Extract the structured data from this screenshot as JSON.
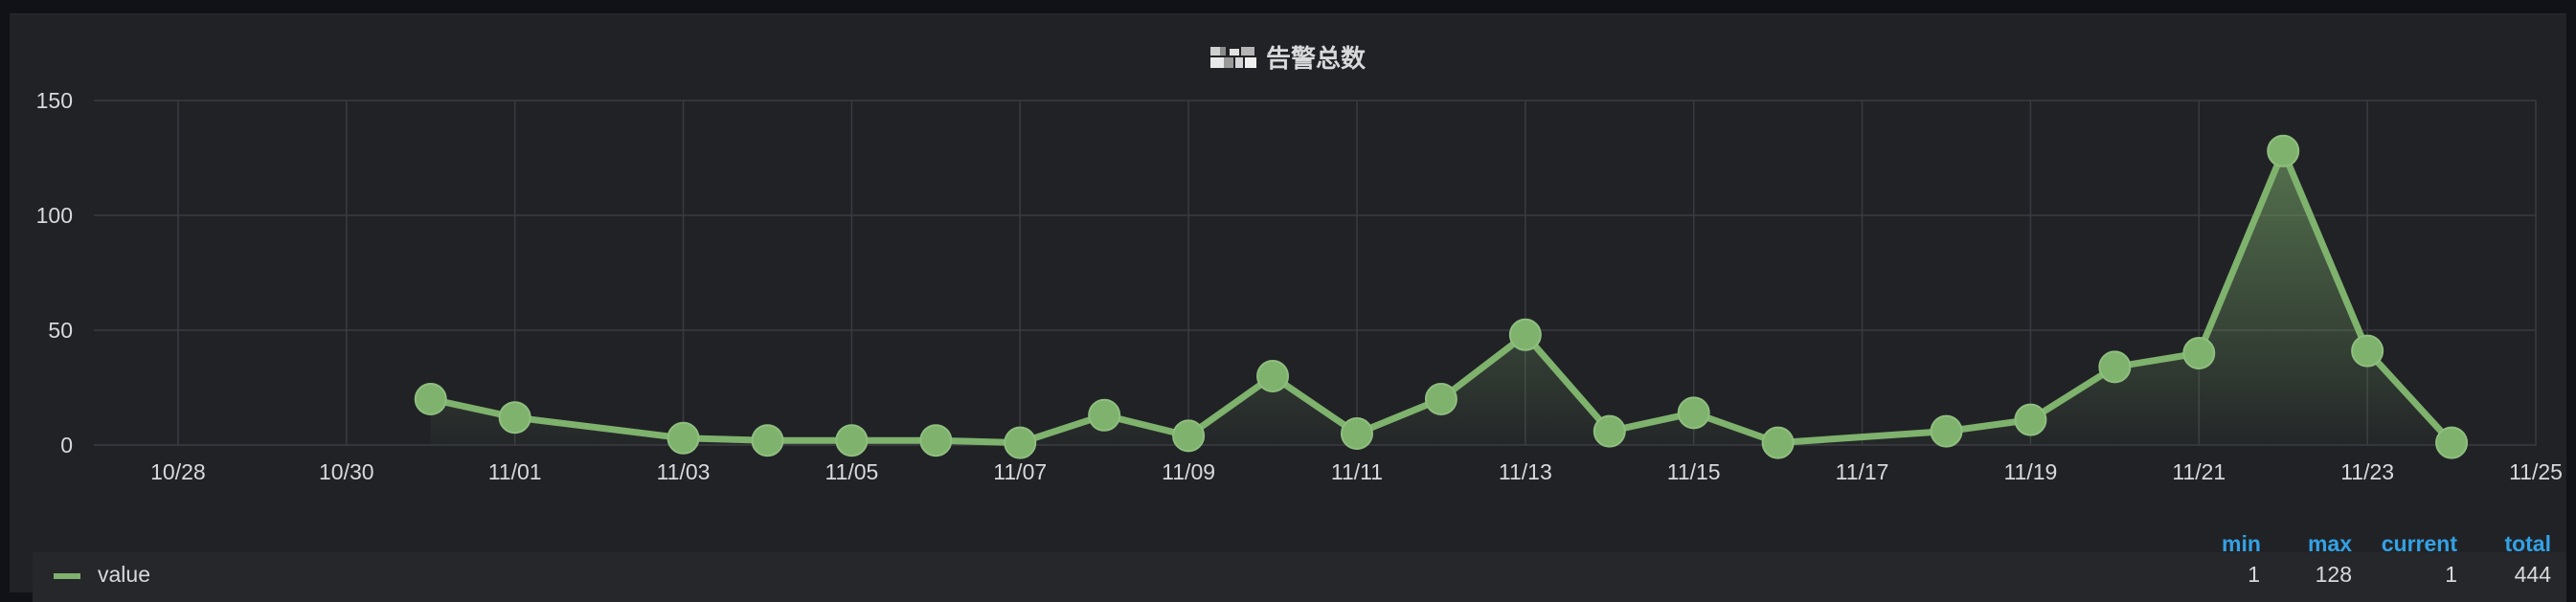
{
  "panel": {
    "title": "告警总数"
  },
  "chart_data": {
    "type": "line",
    "x": [
      "10/31",
      "11/01",
      "11/03",
      "11/04",
      "11/05",
      "11/06",
      "11/07",
      "11/08",
      "11/09",
      "11/10",
      "11/11",
      "11/12",
      "11/13",
      "11/14",
      "11/15",
      "11/16",
      "11/18",
      "11/19",
      "11/20",
      "11/21",
      "11/22",
      "11/23",
      "11/24"
    ],
    "series": [
      {
        "name": "value",
        "values": [
          20,
          12,
          3,
          2,
          2,
          2,
          1,
          13,
          4,
          30,
          5,
          20,
          48,
          6,
          14,
          1,
          6,
          11,
          34,
          40,
          128,
          41,
          1
        ],
        "color": "#7eb26d"
      }
    ],
    "x_ticks": [
      "10/28",
      "10/30",
      "11/01",
      "11/03",
      "11/05",
      "11/07",
      "11/09",
      "11/11",
      "11/13",
      "11/15",
      "11/17",
      "11/19",
      "11/21",
      "11/23",
      "11/25"
    ],
    "y_ticks": [
      "0",
      "50",
      "100",
      "150"
    ],
    "xlim": [
      "10/27",
      "11/25"
    ],
    "ylim": [
      0,
      150
    ],
    "grid": true,
    "legend_position": "bottom"
  },
  "legend": {
    "headers": [
      "min",
      "max",
      "current",
      "total"
    ],
    "rows": [
      {
        "name": "value",
        "min": "1",
        "max": "128",
        "current": "1",
        "total": "444"
      }
    ]
  }
}
